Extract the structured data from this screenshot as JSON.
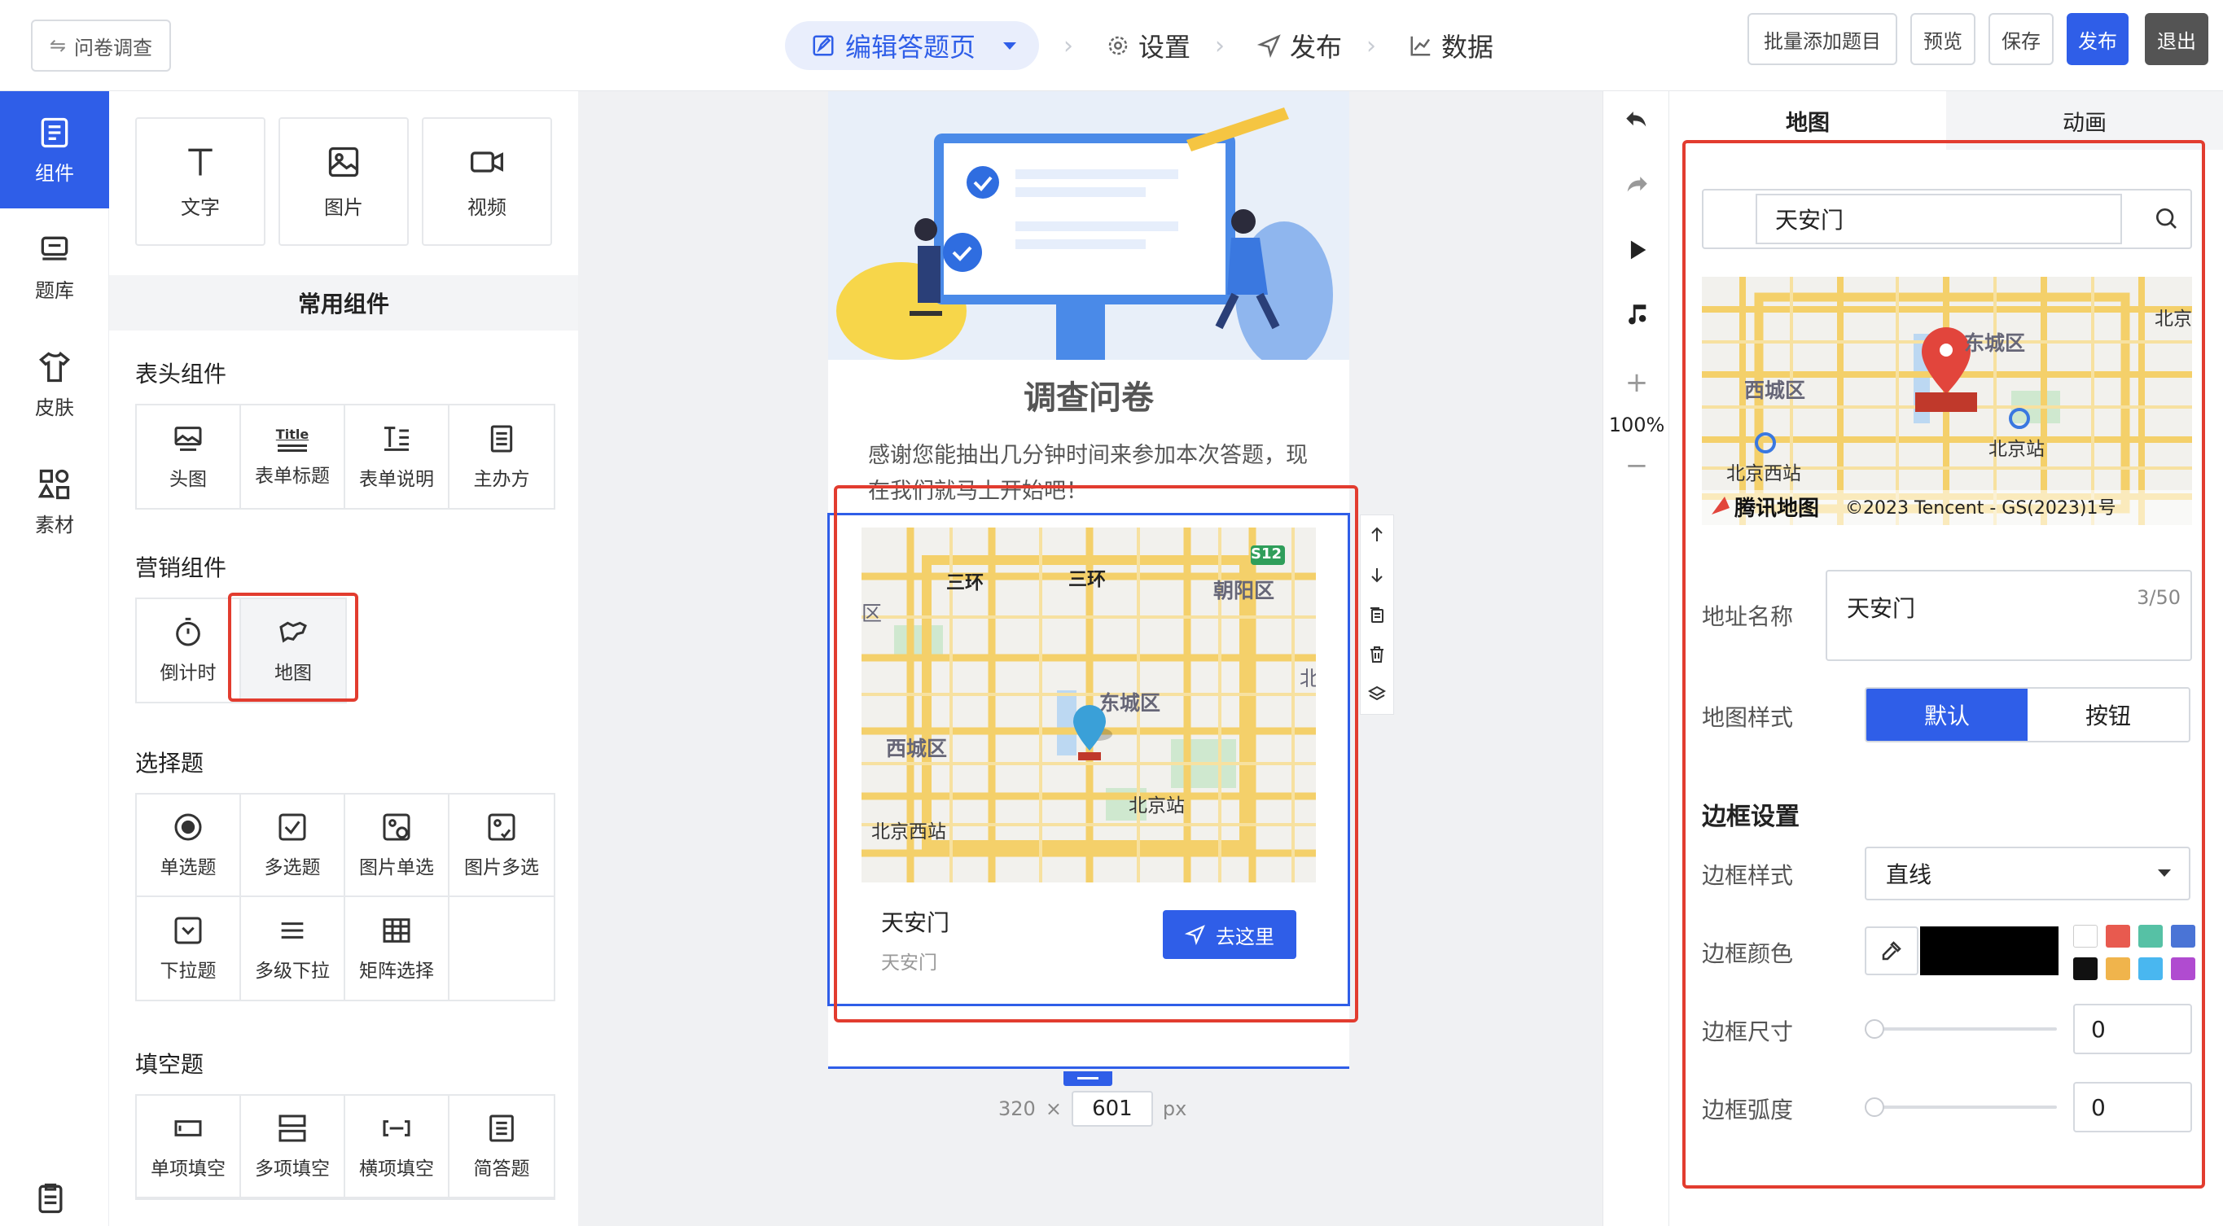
{
  "topbar": {
    "back_label": "问卷调查",
    "steps": [
      "编辑答题页",
      "设置",
      "发布",
      "数据"
    ],
    "actions": [
      "批量添加题目",
      "预览",
      "保存",
      "发布",
      "退出"
    ]
  },
  "leftnav": [
    "组件",
    "题库",
    "皮肤",
    "素材"
  ],
  "components": {
    "basic": [
      "文字",
      "图片",
      "视频"
    ],
    "common_title": "常用组件",
    "header_title": "表头组件",
    "header_items": [
      "头图",
      "表单标题",
      "表单说明",
      "主办方"
    ],
    "marketing_title": "营销组件",
    "marketing_items": [
      "倒计时",
      "地图"
    ],
    "choice_title": "选择题",
    "choice_items": [
      "单选题",
      "多选题",
      "图片单选",
      "图片多选",
      "下拉题",
      "多级下拉",
      "矩阵选择"
    ],
    "fill_title": "填空题",
    "fill_items": [
      "单项填空",
      "多项填空",
      "横项填空",
      "简答题"
    ],
    "title_icon_text": "Title"
  },
  "canvas": {
    "survey_title": "调查问卷",
    "survey_desc": "感谢您能抽出几分钟时间来参加本次答题，现在我们就马上开始吧！",
    "map_labels": [
      "三环",
      "三环",
      "朝阳区",
      "东城区",
      "西城区",
      "北京站",
      "北京西站",
      "S12",
      "区",
      "北"
    ],
    "place_name": "天安门",
    "place_sub": "天安门",
    "go_label": "去这里",
    "width_value": "320",
    "times": "×",
    "height_value": "601",
    "unit": "px"
  },
  "right_tools": {
    "zoom": "100%",
    "plus": "+",
    "minus": "−"
  },
  "props": {
    "tabs": [
      "地图",
      "动画"
    ],
    "search_value": "天安门",
    "mini_map_labels": [
      "东城区",
      "西城区",
      "北京站",
      "北京西站",
      "北京"
    ],
    "map_brand": "腾讯地图",
    "map_copyright": "©2023 Tencent - GS(2023)1号",
    "addr_label": "地址名称",
    "addr_value": "天安门",
    "addr_count": "3/50",
    "style_label": "地图样式",
    "style_options": [
      "默认",
      "按钮"
    ],
    "border_title": "边框设置",
    "border_style_label": "边框样式",
    "border_style_value": "直线",
    "border_color_label": "边框颜色",
    "border_size_label": "边框尺寸",
    "border_size_value": "0",
    "border_radius_label": "边框弧度",
    "border_radius_value": "0",
    "palette": [
      "#ffffff",
      "#e85a4f",
      "#56c1a5",
      "#4a74d6",
      "#111111",
      "#f0b44c",
      "#49b7f0",
      "#b04bd0"
    ],
    "border_color": "#000000"
  }
}
